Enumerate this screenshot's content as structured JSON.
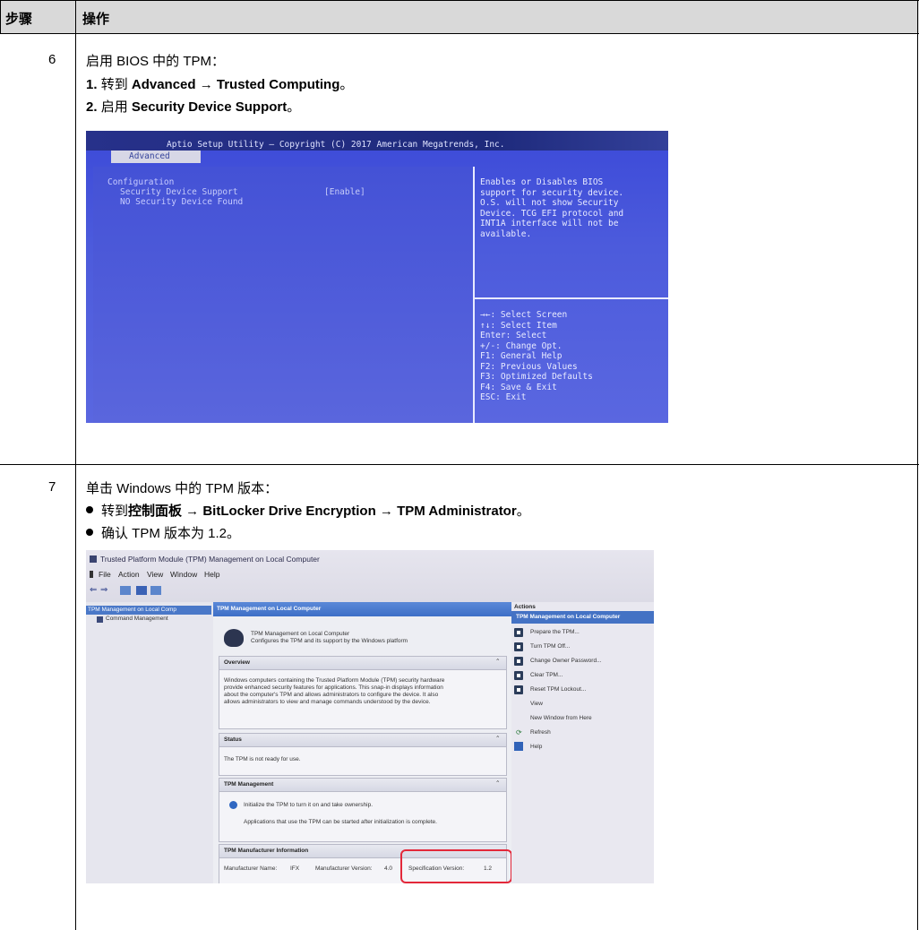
{
  "table": {
    "header": {
      "step": "步骤",
      "operation": "操作"
    },
    "rows": [
      {
        "step": "6",
        "intro": "启用 BIOS 中的 TPM：",
        "items": [
          {
            "num": "1.",
            "text_pre": "转到 ",
            "bold": "Advanced → Trusted Computing",
            "text_post": "。"
          },
          {
            "num": "2.",
            "text_pre": "启用 ",
            "bold": "Security Device Support",
            "text_post": "。"
          }
        ]
      },
      {
        "step": "7",
        "intro": "单击 Windows 中的 TPM 版本：",
        "bullets": [
          {
            "text_pre": "转到",
            "bold": "控制面板 → BitLocker Drive Encryption → TPM Administrator",
            "text_post": "。"
          },
          {
            "text": "确认 TPM 版本为 1.2。"
          }
        ]
      }
    ]
  },
  "bios": {
    "title": "Aptio Setup Utility – Copyright (C) 2017 American Megatrends, Inc.",
    "tab": "Advanced",
    "config_label": "Configuration",
    "option_label": "Security Device Support",
    "option_value": "[Enable]",
    "status_line": "NO Security Device Found",
    "help_text": [
      "Enables or Disables BIOS",
      "support for security device.",
      "O.S. will not show Security",
      "Device. TCG EFI protocol and",
      "INT1A interface will not be",
      "available."
    ],
    "keys": [
      "→←: Select Screen",
      "↑↓: Select Item",
      "Enter: Select",
      "+/-: Change Opt.",
      "F1: General Help",
      "F2: Previous Values",
      "F3: Optimized Defaults",
      "F4: Save & Exit",
      "ESC: Exit"
    ]
  },
  "tpm": {
    "window_title": "Trusted Platform Module (TPM) Management on Local Computer",
    "menu": [
      "File",
      "Action",
      "View",
      "Window",
      "Help"
    ],
    "tree": {
      "root": "TPM Management on Local Comp",
      "child": "Command Management"
    },
    "main_header": "TPM Management on Local Computer",
    "intro_title": "TPM Management on Local Computer",
    "intro_desc": "Configures the TPM and its support by the Windows platform",
    "overview": {
      "title": "Overview",
      "lines": [
        "Windows computers containing the Trusted Platform Module (TPM) security hardware",
        "provide enhanced security features for applications. This snap-in displays information",
        "about the computer's TPM and allows administrators to configure the device. It also",
        "allows administrators to view and manage commands understood by the device."
      ]
    },
    "status": {
      "title": "Status",
      "text": "The TPM is not ready for use."
    },
    "management": {
      "title": "TPM Management",
      "line1": "Initialize the TPM to turn it on and take ownership.",
      "line2": "Applications that use the TPM can be started after initialization is complete."
    },
    "manufacturer": {
      "title": "TPM Manufacturer Information",
      "name_label": "Manufacturer Name:",
      "name_value": "IFX",
      "version_label": "Manufacturer Version:",
      "version_value": "4.0",
      "spec_label": "Specification Version:",
      "spec_value": "1.2"
    },
    "actions": {
      "title": "Actions",
      "subheader": "TPM Management on Local Computer",
      "items": [
        "Prepare the TPM...",
        "Turn TPM Off...",
        "Change Owner Password...",
        "Clear TPM...",
        "Reset TPM Lockout...",
        "View",
        "New Window from Here",
        "Refresh",
        "Help"
      ]
    }
  }
}
